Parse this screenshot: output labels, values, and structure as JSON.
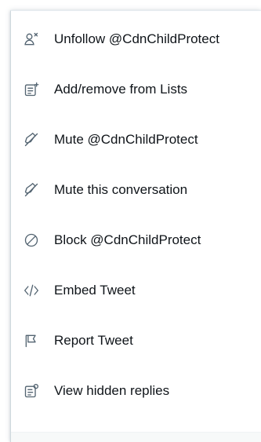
{
  "menu": {
    "items": [
      {
        "icon": "unfollow-user-icon",
        "label": "Unfollow @CdnChildProtect"
      },
      {
        "icon": "lists-icon",
        "label": "Add/remove from Lists"
      },
      {
        "icon": "mute-icon",
        "label": "Mute @CdnChildProtect"
      },
      {
        "icon": "mute-conversation-icon",
        "label": "Mute this conversation"
      },
      {
        "icon": "block-icon",
        "label": "Block @CdnChildProtect"
      },
      {
        "icon": "embed-code-icon",
        "label": "Embed Tweet"
      },
      {
        "icon": "report-flag-icon",
        "label": "Report Tweet"
      },
      {
        "icon": "hidden-replies-icon",
        "label": "View hidden replies"
      }
    ]
  },
  "colors": {
    "text": "#0f1419",
    "icon": "#536471",
    "border": "#cfd9de"
  }
}
